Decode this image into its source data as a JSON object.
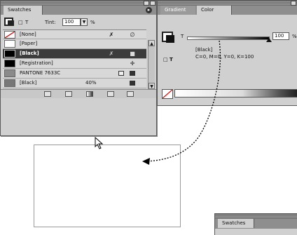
{
  "swatches": {
    "tab_label": "Swatches",
    "tint_label": "Tint:",
    "tint_value": "100",
    "tint_unit": "%",
    "rows": [
      {
        "name": "[None]",
        "color": "#ffffff"
      },
      {
        "name": "[Paper]",
        "color": "#ffffff"
      },
      {
        "name": "[Black]",
        "color": "#000000"
      },
      {
        "name": "[Registration]",
        "color": "#000000"
      },
      {
        "name": "PANTONE 7633C",
        "color": "#8a8a8a"
      },
      {
        "name": "[Black]",
        "color": "#777777",
        "percent": "40%"
      }
    ],
    "menu_icon": "circle-arrow-icon"
  },
  "color_panel": {
    "tabs": [
      "Gradient",
      "Color"
    ],
    "active_tab": "Color",
    "slider_label": "T",
    "slider_value": "100",
    "slider_unit": "%",
    "swatch_name": "[Black]",
    "swatch_value": "C=0, M=0, Y=0, K=100",
    "fill_stroke_icon": "fill-stroke-icon",
    "text_icon": "T"
  },
  "bottom_swatches": {
    "tab_label": "Swatches"
  },
  "colors": {
    "panel_bg": "#d0d0d0",
    "selected_row": "#3c3c3c",
    "drag_arrow": "#000000"
  }
}
